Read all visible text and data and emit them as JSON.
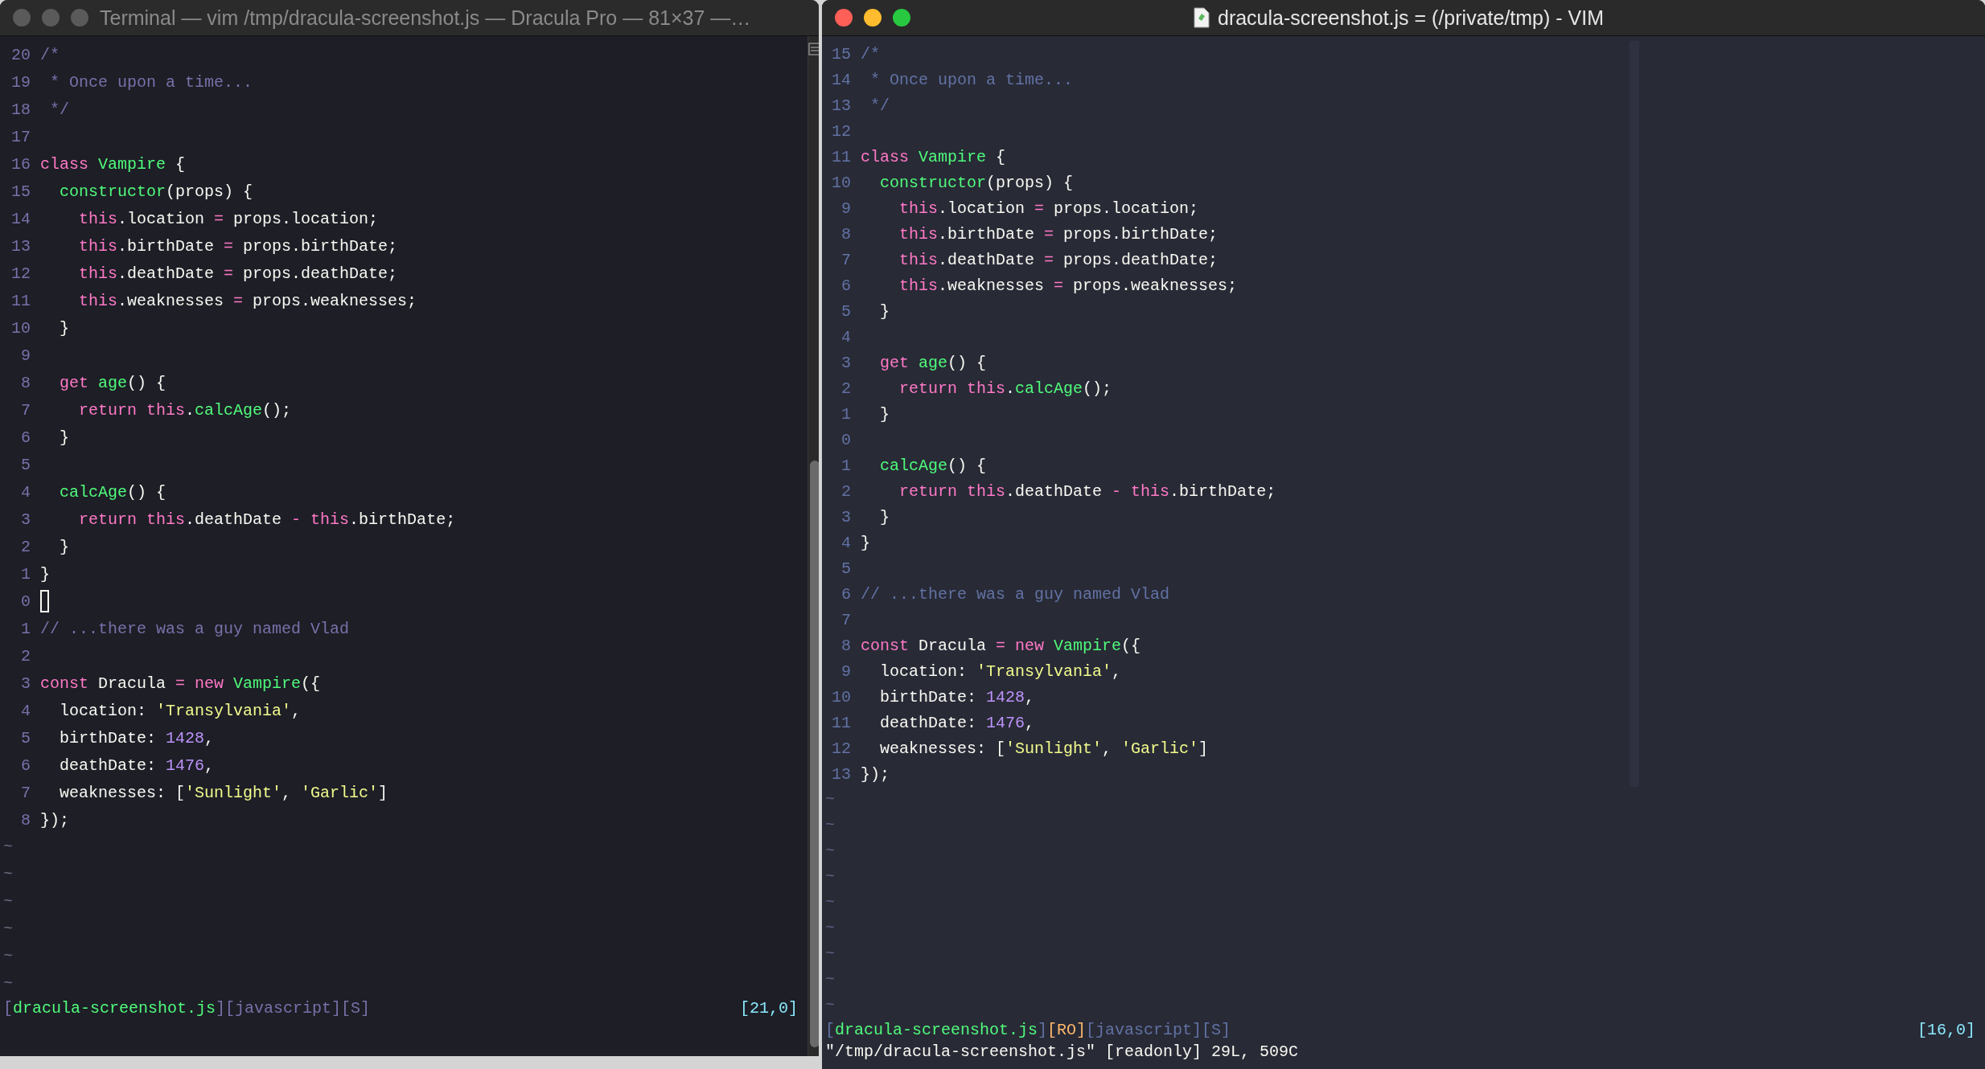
{
  "windows": [
    {
      "kind": "terminal",
      "focused": false,
      "title": "Terminal — vim /tmp/dracula-screenshot.js — Dracula Pro — 81×37 —…",
      "lines": [
        {
          "number": "20",
          "tokens": [
            {
              "kind": "comment",
              "text": "/*"
            }
          ]
        },
        {
          "number": "19",
          "tokens": [
            {
              "kind": "comment",
              "text": " * Once upon a time..."
            }
          ]
        },
        {
          "number": "18",
          "tokens": [
            {
              "kind": "comment",
              "text": " */"
            }
          ]
        },
        {
          "number": "17"
        },
        {
          "number": "16",
          "tokens": [
            {
              "kind": "keyword",
              "text": "class"
            },
            {
              "kind": "function",
              "text": " Vampire"
            },
            {
              "kind": "plain",
              "text": " {"
            }
          ]
        },
        {
          "number": "15",
          "tokens": [
            {
              "kind": "function",
              "text": "  constructor"
            },
            {
              "kind": "plain",
              "text": "(props) {"
            }
          ]
        },
        {
          "number": "14",
          "tokens": [
            {
              "kind": "keyword",
              "text": "    this"
            },
            {
              "kind": "plain",
              "text": ".location"
            },
            {
              "kind": "keyword",
              "text": " ="
            },
            {
              "kind": "plain",
              "text": " props.location;"
            }
          ]
        },
        {
          "number": "13",
          "tokens": [
            {
              "kind": "keyword",
              "text": "    this"
            },
            {
              "kind": "plain",
              "text": ".birthDate"
            },
            {
              "kind": "keyword",
              "text": " ="
            },
            {
              "kind": "plain",
              "text": " props.birthDate;"
            }
          ]
        },
        {
          "number": "12",
          "tokens": [
            {
              "kind": "keyword",
              "text": "    this"
            },
            {
              "kind": "plain",
              "text": ".deathDate"
            },
            {
              "kind": "keyword",
              "text": " ="
            },
            {
              "kind": "plain",
              "text": " props.deathDate;"
            }
          ]
        },
        {
          "number": "11",
          "tokens": [
            {
              "kind": "keyword",
              "text": "    this"
            },
            {
              "kind": "plain",
              "text": ".weaknesses"
            },
            {
              "kind": "keyword",
              "text": " ="
            },
            {
              "kind": "plain",
              "text": " props.weaknesses;"
            }
          ]
        },
        {
          "number": "10",
          "tokens": [
            {
              "kind": "plain",
              "text": "  }"
            }
          ]
        },
        {
          "number": "9"
        },
        {
          "number": "8",
          "tokens": [
            {
              "kind": "keyword",
              "text": "  get"
            },
            {
              "kind": "function",
              "text": " age"
            },
            {
              "kind": "plain",
              "text": "() {"
            }
          ]
        },
        {
          "number": "7",
          "tokens": [
            {
              "kind": "keyword",
              "text": "    return"
            },
            {
              "kind": "keyword",
              "text": " this"
            },
            {
              "kind": "plain",
              "text": "."
            },
            {
              "kind": "function",
              "text": "calcAge"
            },
            {
              "kind": "plain",
              "text": "();"
            }
          ]
        },
        {
          "number": "6",
          "tokens": [
            {
              "kind": "plain",
              "text": "  }"
            }
          ]
        },
        {
          "number": "5"
        },
        {
          "number": "4",
          "tokens": [
            {
              "kind": "function",
              "text": "  calcAge"
            },
            {
              "kind": "plain",
              "text": "() {"
            }
          ]
        },
        {
          "number": "3",
          "tokens": [
            {
              "kind": "keyword",
              "text": "    return"
            },
            {
              "kind": "keyword",
              "text": " this"
            },
            {
              "kind": "plain",
              "text": ".deathDate"
            },
            {
              "kind": "keyword",
              "text": " -"
            },
            {
              "kind": "keyword",
              "text": " this"
            },
            {
              "kind": "plain",
              "text": ".birthDate;"
            }
          ]
        },
        {
          "number": "2",
          "tokens": [
            {
              "kind": "plain",
              "text": "  }"
            }
          ]
        },
        {
          "number": "1",
          "tokens": [
            {
              "kind": "plain",
              "text": "}"
            }
          ]
        },
        {
          "number": "0",
          "cursor": true
        },
        {
          "number": "1",
          "tokens": [
            {
              "kind": "comment",
              "text": "// ...there was a guy named Vlad"
            }
          ]
        },
        {
          "number": "2"
        },
        {
          "number": "3",
          "tokens": [
            {
              "kind": "keyword",
              "text": "const"
            },
            {
              "kind": "plain",
              "text": " Dracula"
            },
            {
              "kind": "keyword",
              "text": " ="
            },
            {
              "kind": "keyword",
              "text": " new"
            },
            {
              "kind": "function",
              "text": " Vampire"
            },
            {
              "kind": "plain",
              "text": "({"
            }
          ]
        },
        {
          "number": "4",
          "tokens": [
            {
              "kind": "plain",
              "text": "  location:"
            },
            {
              "kind": "string",
              "text": " 'Transylvania'"
            },
            {
              "kind": "plain",
              "text": ","
            }
          ]
        },
        {
          "number": "5",
          "tokens": [
            {
              "kind": "plain",
              "text": "  birthDate:"
            },
            {
              "kind": "number",
              "text": " 1428"
            },
            {
              "kind": "plain",
              "text": ","
            }
          ]
        },
        {
          "number": "6",
          "tokens": [
            {
              "kind": "plain",
              "text": "  deathDate:"
            },
            {
              "kind": "number",
              "text": " 1476"
            },
            {
              "kind": "plain",
              "text": ","
            }
          ]
        },
        {
          "number": "7",
          "tokens": [
            {
              "kind": "plain",
              "text": "  weaknesses: ["
            },
            {
              "kind": "string",
              "text": "'Sunlight'"
            },
            {
              "kind": "plain",
              "text": ","
            },
            {
              "kind": "string",
              "text": " 'Garlic'"
            },
            {
              "kind": "plain",
              "text": "]"
            }
          ]
        },
        {
          "number": "8",
          "tokens": [
            {
              "kind": "plain",
              "text": "});"
            }
          ]
        }
      ],
      "tildes": [
        "~",
        "~",
        "~",
        "~",
        "~",
        "~"
      ],
      "status": [
        {
          "kind": "bracket",
          "text": "["
        },
        {
          "kind": "file",
          "text": "dracula-screenshot.js"
        },
        {
          "kind": "bracket",
          "text": "][javascript][S]"
        }
      ],
      "position": "[21,0]"
    },
    {
      "kind": "gui",
      "focused": true,
      "title": "dracula-screenshot.js = (/private/tmp) - VIM",
      "lines": [
        {
          "number": "15",
          "tokens": [
            {
              "kind": "comment",
              "text": "/*"
            }
          ]
        },
        {
          "number": "14",
          "tokens": [
            {
              "kind": "comment",
              "text": " * Once upon a time..."
            }
          ]
        },
        {
          "number": "13",
          "tokens": [
            {
              "kind": "comment",
              "text": " */"
            }
          ]
        },
        {
          "number": "12"
        },
        {
          "number": "11",
          "tokens": [
            {
              "kind": "keyword",
              "text": "class"
            },
            {
              "kind": "function",
              "text": " Vampire"
            },
            {
              "kind": "plain",
              "text": " {"
            }
          ]
        },
        {
          "number": "10",
          "tokens": [
            {
              "kind": "function",
              "text": "  constructor"
            },
            {
              "kind": "plain",
              "text": "(props) {"
            }
          ]
        },
        {
          "number": "9",
          "tokens": [
            {
              "kind": "keyword",
              "text": "    this"
            },
            {
              "kind": "plain",
              "text": ".location"
            },
            {
              "kind": "keyword",
              "text": " ="
            },
            {
              "kind": "plain",
              "text": " props.location;"
            }
          ]
        },
        {
          "number": "8",
          "tokens": [
            {
              "kind": "keyword",
              "text": "    this"
            },
            {
              "kind": "plain",
              "text": ".birthDate"
            },
            {
              "kind": "keyword",
              "text": " ="
            },
            {
              "kind": "plain",
              "text": " props.birthDate;"
            }
          ]
        },
        {
          "number": "7",
          "tokens": [
            {
              "kind": "keyword",
              "text": "    this"
            },
            {
              "kind": "plain",
              "text": ".deathDate"
            },
            {
              "kind": "keyword",
              "text": " ="
            },
            {
              "kind": "plain",
              "text": " props.deathDate;"
            }
          ]
        },
        {
          "number": "6",
          "tokens": [
            {
              "kind": "keyword",
              "text": "    this"
            },
            {
              "kind": "plain",
              "text": ".weaknesses"
            },
            {
              "kind": "keyword",
              "text": " ="
            },
            {
              "kind": "plain",
              "text": " props.weaknesses;"
            }
          ]
        },
        {
          "number": "5",
          "tokens": [
            {
              "kind": "plain",
              "text": "  }"
            }
          ]
        },
        {
          "number": "4"
        },
        {
          "number": "3",
          "tokens": [
            {
              "kind": "keyword",
              "text": "  get"
            },
            {
              "kind": "function",
              "text": " age"
            },
            {
              "kind": "plain",
              "text": "() {"
            }
          ]
        },
        {
          "number": "2",
          "tokens": [
            {
              "kind": "keyword",
              "text": "    return"
            },
            {
              "kind": "keyword",
              "text": " this"
            },
            {
              "kind": "plain",
              "text": "."
            },
            {
              "kind": "function",
              "text": "calcAge"
            },
            {
              "kind": "plain",
              "text": "();"
            }
          ]
        },
        {
          "number": "1",
          "tokens": [
            {
              "kind": "plain",
              "text": "  }"
            }
          ]
        },
        {
          "number": "0"
        },
        {
          "number": "1",
          "tokens": [
            {
              "kind": "function",
              "text": "  calcAge"
            },
            {
              "kind": "plain",
              "text": "() {"
            }
          ]
        },
        {
          "number": "2",
          "tokens": [
            {
              "kind": "keyword",
              "text": "    return"
            },
            {
              "kind": "keyword",
              "text": " this"
            },
            {
              "kind": "plain",
              "text": ".deathDate"
            },
            {
              "kind": "keyword",
              "text": " -"
            },
            {
              "kind": "keyword",
              "text": " this"
            },
            {
              "kind": "plain",
              "text": ".birthDate;"
            }
          ]
        },
        {
          "number": "3",
          "tokens": [
            {
              "kind": "plain",
              "text": "  }"
            }
          ]
        },
        {
          "number": "4",
          "tokens": [
            {
              "kind": "plain",
              "text": "}"
            }
          ]
        },
        {
          "number": "5"
        },
        {
          "number": "6",
          "tokens": [
            {
              "kind": "comment",
              "text": "// ...there was a guy named Vlad"
            }
          ]
        },
        {
          "number": "7"
        },
        {
          "number": "8",
          "tokens": [
            {
              "kind": "keyword",
              "text": "const"
            },
            {
              "kind": "plain",
              "text": " Dracula"
            },
            {
              "kind": "keyword",
              "text": " ="
            },
            {
              "kind": "keyword",
              "text": " new"
            },
            {
              "kind": "function",
              "text": " Vampire"
            },
            {
              "kind": "plain",
              "text": "({"
            }
          ]
        },
        {
          "number": "9",
          "tokens": [
            {
              "kind": "plain",
              "text": "  location:"
            },
            {
              "kind": "string",
              "text": " 'Transylvania'"
            },
            {
              "kind": "plain",
              "text": ","
            }
          ]
        },
        {
          "number": "10",
          "tokens": [
            {
              "kind": "plain",
              "text": "  birthDate:"
            },
            {
              "kind": "number",
              "text": " 1428"
            },
            {
              "kind": "plain",
              "text": ","
            }
          ]
        },
        {
          "number": "11",
          "tokens": [
            {
              "kind": "plain",
              "text": "  deathDate:"
            },
            {
              "kind": "number",
              "text": " 1476"
            },
            {
              "kind": "plain",
              "text": ","
            }
          ]
        },
        {
          "number": "12",
          "tokens": [
            {
              "kind": "plain",
              "text": "  weaknesses: ["
            },
            {
              "kind": "string",
              "text": "'Sunlight'"
            },
            {
              "kind": "plain",
              "text": ","
            },
            {
              "kind": "string",
              "text": " 'Garlic'"
            },
            {
              "kind": "plain",
              "text": "]"
            }
          ]
        },
        {
          "number": "13",
          "tokens": [
            {
              "kind": "plain",
              "text": "});"
            }
          ]
        }
      ],
      "tildes": [
        "~",
        "~",
        "~",
        "~",
        "~",
        "~",
        "~",
        "~",
        "~"
      ],
      "status": [
        {
          "kind": "bracket",
          "text": "["
        },
        {
          "kind": "file",
          "text": "dracula-screenshot.js"
        },
        {
          "kind": "bracket",
          "text": "]"
        },
        {
          "kind": "readonly",
          "text": "[RO]"
        },
        {
          "kind": "bracket",
          "text": "[javascript][S]"
        }
      ],
      "position": "[16,0]",
      "message": "\"/tmp/dracula-screenshot.js\" [readonly] 29L, 509C"
    }
  ]
}
